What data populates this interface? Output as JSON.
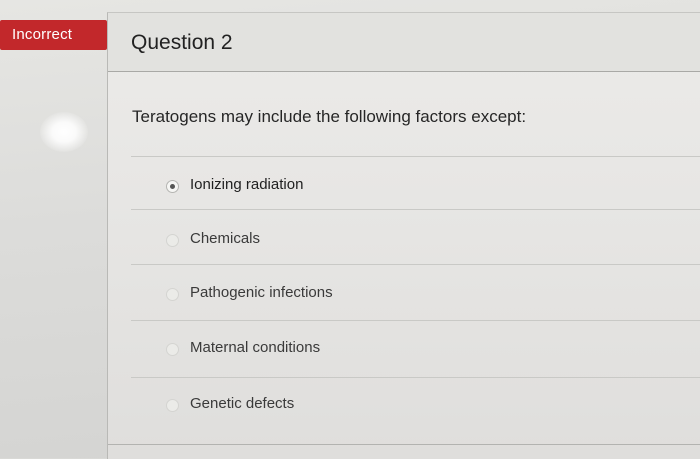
{
  "status": {
    "label": "Incorrect",
    "color": "#c2282b"
  },
  "question": {
    "title": "Question 2",
    "prompt": "Teratogens may include the following factors except:",
    "options": [
      {
        "label": "Ionizing radiation",
        "selected": true
      },
      {
        "label": "Chemicals",
        "selected": false
      },
      {
        "label": "Pathogenic infections",
        "selected": false
      },
      {
        "label": "Maternal conditions",
        "selected": false
      },
      {
        "label": "Genetic defects",
        "selected": false
      }
    ]
  }
}
